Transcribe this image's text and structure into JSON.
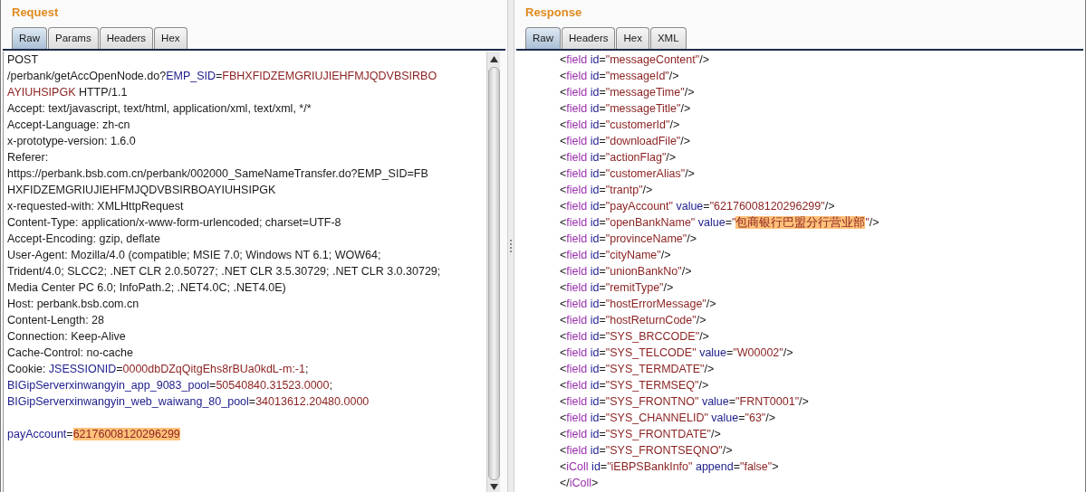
{
  "request": {
    "title": "Request",
    "tabs": [
      {
        "label": "Raw",
        "selected": true
      },
      {
        "label": "Params",
        "selected": false
      },
      {
        "label": "Headers",
        "selected": false
      },
      {
        "label": "Hex",
        "selected": false
      }
    ],
    "lines": [
      {
        "kind": "text",
        "segments": [
          {
            "kind": "plain",
            "text": "POST"
          }
        ]
      },
      {
        "kind": "text",
        "segments": [
          {
            "kind": "plain",
            "text": "/perbank/getAccOpenNode.do?"
          },
          {
            "kind": "name",
            "text": "EMP_SID"
          },
          {
            "kind": "plain",
            "text": "="
          },
          {
            "kind": "value",
            "text": "FBHXFIDZEMGRIUJIEHFMJQDVBSIRBO"
          }
        ]
      },
      {
        "kind": "text",
        "segments": [
          {
            "kind": "value",
            "text": "AYIUHSIPGK"
          },
          {
            "kind": "plain",
            "text": " HTTP/1.1"
          }
        ]
      },
      {
        "kind": "text",
        "segments": [
          {
            "kind": "plain",
            "text": "Accept: text/javascript, text/html, application/xml, text/xml, */*"
          }
        ]
      },
      {
        "kind": "text",
        "segments": [
          {
            "kind": "plain",
            "text": "Accept-Language: zh-cn"
          }
        ]
      },
      {
        "kind": "text",
        "segments": [
          {
            "kind": "plain",
            "text": "x-prototype-version: 1.6.0"
          }
        ]
      },
      {
        "kind": "text",
        "segments": [
          {
            "kind": "plain",
            "text": "Referer:"
          }
        ]
      },
      {
        "kind": "text",
        "segments": [
          {
            "kind": "plain",
            "text": "https://perbank.bsb.com.cn/perbank/002000_SameNameTransfer.do?EMP_SID=FB"
          }
        ]
      },
      {
        "kind": "text",
        "segments": [
          {
            "kind": "plain",
            "text": "HXFIDZEMGRIUJIEHFMJQDVBSIRBOAYIUHSIPGK"
          }
        ]
      },
      {
        "kind": "text",
        "segments": [
          {
            "kind": "plain",
            "text": "x-requested-with: XMLHttpRequest"
          }
        ]
      },
      {
        "kind": "text",
        "segments": [
          {
            "kind": "plain",
            "text": "Content-Type: application/x-www-form-urlencoded; charset=UTF-8"
          }
        ]
      },
      {
        "kind": "text",
        "segments": [
          {
            "kind": "plain",
            "text": "Accept-Encoding: gzip, deflate"
          }
        ]
      },
      {
        "kind": "text",
        "segments": [
          {
            "kind": "plain",
            "text": "User-Agent: Mozilla/4.0 (compatible; MSIE 7.0; Windows NT 6.1; WOW64;"
          }
        ]
      },
      {
        "kind": "text",
        "segments": [
          {
            "kind": "plain",
            "text": "Trident/4.0; SLCC2; .NET CLR 2.0.50727; .NET CLR 3.5.30729; .NET CLR 3.0.30729;"
          }
        ]
      },
      {
        "kind": "text",
        "segments": [
          {
            "kind": "plain",
            "text": "Media Center PC 6.0; InfoPath.2; .NET4.0C; .NET4.0E)"
          }
        ]
      },
      {
        "kind": "text",
        "segments": [
          {
            "kind": "plain",
            "text": "Host: perbank.bsb.com.cn"
          }
        ]
      },
      {
        "kind": "text",
        "segments": [
          {
            "kind": "plain",
            "text": "Content-Length: 28"
          }
        ]
      },
      {
        "kind": "text",
        "segments": [
          {
            "kind": "plain",
            "text": "Connection: Keep-Alive"
          }
        ]
      },
      {
        "kind": "text",
        "segments": [
          {
            "kind": "plain",
            "text": "Cache-Control: no-cache"
          }
        ]
      },
      {
        "kind": "text",
        "segments": [
          {
            "kind": "plain",
            "text": "Cookie: "
          },
          {
            "kind": "name",
            "text": "JSESSIONID"
          },
          {
            "kind": "plain",
            "text": "="
          },
          {
            "kind": "value",
            "text": "0000dbDZqQitgEhs8rBUa0kdL-m:-1"
          },
          {
            "kind": "plain",
            "text": ";"
          }
        ]
      },
      {
        "kind": "text",
        "segments": [
          {
            "kind": "name",
            "text": "BIGipServerxinwangyin_app_9083_pool"
          },
          {
            "kind": "plain",
            "text": "="
          },
          {
            "kind": "value",
            "text": "50540840.31523.0000"
          },
          {
            "kind": "plain",
            "text": ";"
          }
        ]
      },
      {
        "kind": "text",
        "segments": [
          {
            "kind": "name",
            "text": "BIGipServerxinwangyin_web_waiwang_80_pool"
          },
          {
            "kind": "plain",
            "text": "="
          },
          {
            "kind": "value",
            "text": "34013612.20480.0000"
          }
        ]
      },
      {
        "kind": "blank"
      },
      {
        "kind": "text",
        "segments": [
          {
            "kind": "name",
            "text": "payAccount"
          },
          {
            "kind": "plain",
            "text": "="
          },
          {
            "kind": "highlight",
            "text": "62176008120296299"
          }
        ]
      }
    ]
  },
  "response": {
    "title": "Response",
    "tabs": [
      {
        "label": "Raw",
        "selected": true
      },
      {
        "label": "Headers",
        "selected": false
      },
      {
        "label": "Hex",
        "selected": false
      },
      {
        "label": "XML",
        "selected": false
      }
    ],
    "lines": [
      {
        "kind": "text",
        "segments": [
          {
            "kind": "plain",
            "text": "<"
          },
          {
            "kind": "tag",
            "text": "field"
          },
          {
            "kind": "name",
            "text": " id"
          },
          {
            "kind": "plain",
            "text": "="
          },
          {
            "kind": "value",
            "text": "\"messageContent\""
          },
          {
            "kind": "plain",
            "text": "/>"
          }
        ]
      },
      {
        "kind": "text",
        "segments": [
          {
            "kind": "plain",
            "text": "<"
          },
          {
            "kind": "tag",
            "text": "field"
          },
          {
            "kind": "name",
            "text": " id"
          },
          {
            "kind": "plain",
            "text": "="
          },
          {
            "kind": "value",
            "text": "\"messageId\""
          },
          {
            "kind": "plain",
            "text": "/>"
          }
        ]
      },
      {
        "kind": "text",
        "segments": [
          {
            "kind": "plain",
            "text": "<"
          },
          {
            "kind": "tag",
            "text": "field"
          },
          {
            "kind": "name",
            "text": " id"
          },
          {
            "kind": "plain",
            "text": "="
          },
          {
            "kind": "value",
            "text": "\"messageTime\""
          },
          {
            "kind": "plain",
            "text": "/>"
          }
        ]
      },
      {
        "kind": "text",
        "segments": [
          {
            "kind": "plain",
            "text": "<"
          },
          {
            "kind": "tag",
            "text": "field"
          },
          {
            "kind": "name",
            "text": " id"
          },
          {
            "kind": "plain",
            "text": "="
          },
          {
            "kind": "value",
            "text": "\"messageTitle\""
          },
          {
            "kind": "plain",
            "text": "/>"
          }
        ]
      },
      {
        "kind": "text",
        "segments": [
          {
            "kind": "plain",
            "text": "<"
          },
          {
            "kind": "tag",
            "text": "field"
          },
          {
            "kind": "name",
            "text": " id"
          },
          {
            "kind": "plain",
            "text": "="
          },
          {
            "kind": "value",
            "text": "\"customerId\""
          },
          {
            "kind": "plain",
            "text": "/>"
          }
        ]
      },
      {
        "kind": "text",
        "segments": [
          {
            "kind": "plain",
            "text": "<"
          },
          {
            "kind": "tag",
            "text": "field"
          },
          {
            "kind": "name",
            "text": " id"
          },
          {
            "kind": "plain",
            "text": "="
          },
          {
            "kind": "value",
            "text": "\"downloadFile\""
          },
          {
            "kind": "plain",
            "text": "/>"
          }
        ]
      },
      {
        "kind": "text",
        "segments": [
          {
            "kind": "plain",
            "text": "<"
          },
          {
            "kind": "tag",
            "text": "field"
          },
          {
            "kind": "name",
            "text": " id"
          },
          {
            "kind": "plain",
            "text": "="
          },
          {
            "kind": "value",
            "text": "\"actionFlag\""
          },
          {
            "kind": "plain",
            "text": "/>"
          }
        ]
      },
      {
        "kind": "text",
        "segments": [
          {
            "kind": "plain",
            "text": "<"
          },
          {
            "kind": "tag",
            "text": "field"
          },
          {
            "kind": "name",
            "text": " id"
          },
          {
            "kind": "plain",
            "text": "="
          },
          {
            "kind": "value",
            "text": "\"customerAlias\""
          },
          {
            "kind": "plain",
            "text": "/>"
          }
        ]
      },
      {
        "kind": "text",
        "segments": [
          {
            "kind": "plain",
            "text": "<"
          },
          {
            "kind": "tag",
            "text": "field"
          },
          {
            "kind": "name",
            "text": " id"
          },
          {
            "kind": "plain",
            "text": "="
          },
          {
            "kind": "value",
            "text": "\"trantp\""
          },
          {
            "kind": "plain",
            "text": "/>"
          }
        ]
      },
      {
        "kind": "text",
        "segments": [
          {
            "kind": "plain",
            "text": "<"
          },
          {
            "kind": "tag",
            "text": "field"
          },
          {
            "kind": "name",
            "text": " id"
          },
          {
            "kind": "plain",
            "text": "="
          },
          {
            "kind": "value",
            "text": "\"payAccount\""
          },
          {
            "kind": "name",
            "text": " value"
          },
          {
            "kind": "plain",
            "text": "="
          },
          {
            "kind": "value",
            "text": "\"62176008120296299\""
          },
          {
            "kind": "plain",
            "text": "/>"
          }
        ]
      },
      {
        "kind": "text",
        "segments": [
          {
            "kind": "plain",
            "text": "<"
          },
          {
            "kind": "tag",
            "text": "field"
          },
          {
            "kind": "name",
            "text": " id"
          },
          {
            "kind": "plain",
            "text": "="
          },
          {
            "kind": "value",
            "text": "\"openBankName\""
          },
          {
            "kind": "name",
            "text": " value"
          },
          {
            "kind": "plain",
            "text": "="
          },
          {
            "kind": "value",
            "text": "\""
          },
          {
            "kind": "highlight",
            "text": "包商银行巴盟分行营业部"
          },
          {
            "kind": "value",
            "text": "\""
          },
          {
            "kind": "plain",
            "text": "/>"
          }
        ]
      },
      {
        "kind": "text",
        "segments": [
          {
            "kind": "plain",
            "text": "<"
          },
          {
            "kind": "tag",
            "text": "field"
          },
          {
            "kind": "name",
            "text": " id"
          },
          {
            "kind": "plain",
            "text": "="
          },
          {
            "kind": "value",
            "text": "\"provinceName\""
          },
          {
            "kind": "plain",
            "text": "/>"
          }
        ]
      },
      {
        "kind": "text",
        "segments": [
          {
            "kind": "plain",
            "text": "<"
          },
          {
            "kind": "tag",
            "text": "field"
          },
          {
            "kind": "name",
            "text": " id"
          },
          {
            "kind": "plain",
            "text": "="
          },
          {
            "kind": "value",
            "text": "\"cityName\""
          },
          {
            "kind": "plain",
            "text": "/>"
          }
        ]
      },
      {
        "kind": "text",
        "segments": [
          {
            "kind": "plain",
            "text": "<"
          },
          {
            "kind": "tag",
            "text": "field"
          },
          {
            "kind": "name",
            "text": " id"
          },
          {
            "kind": "plain",
            "text": "="
          },
          {
            "kind": "value",
            "text": "\"unionBankNo\""
          },
          {
            "kind": "plain",
            "text": "/>"
          }
        ]
      },
      {
        "kind": "text",
        "segments": [
          {
            "kind": "plain",
            "text": "<"
          },
          {
            "kind": "tag",
            "text": "field"
          },
          {
            "kind": "name",
            "text": " id"
          },
          {
            "kind": "plain",
            "text": "="
          },
          {
            "kind": "value",
            "text": "\"remitType\""
          },
          {
            "kind": "plain",
            "text": "/>"
          }
        ]
      },
      {
        "kind": "text",
        "segments": [
          {
            "kind": "plain",
            "text": "<"
          },
          {
            "kind": "tag",
            "text": "field"
          },
          {
            "kind": "name",
            "text": " id"
          },
          {
            "kind": "plain",
            "text": "="
          },
          {
            "kind": "value",
            "text": "\"hostErrorMessage\""
          },
          {
            "kind": "plain",
            "text": "/>"
          }
        ]
      },
      {
        "kind": "text",
        "segments": [
          {
            "kind": "plain",
            "text": "<"
          },
          {
            "kind": "tag",
            "text": "field"
          },
          {
            "kind": "name",
            "text": " id"
          },
          {
            "kind": "plain",
            "text": "="
          },
          {
            "kind": "value",
            "text": "\"hostReturnCode\""
          },
          {
            "kind": "plain",
            "text": "/>"
          }
        ]
      },
      {
        "kind": "text",
        "segments": [
          {
            "kind": "plain",
            "text": "<"
          },
          {
            "kind": "tag",
            "text": "field"
          },
          {
            "kind": "name",
            "text": " id"
          },
          {
            "kind": "plain",
            "text": "="
          },
          {
            "kind": "value",
            "text": "\"SYS_BRCCODE\""
          },
          {
            "kind": "plain",
            "text": "/>"
          }
        ]
      },
      {
        "kind": "text",
        "segments": [
          {
            "kind": "plain",
            "text": "<"
          },
          {
            "kind": "tag",
            "text": "field"
          },
          {
            "kind": "name",
            "text": " id"
          },
          {
            "kind": "plain",
            "text": "="
          },
          {
            "kind": "value",
            "text": "\"SYS_TELCODE\""
          },
          {
            "kind": "name",
            "text": " value"
          },
          {
            "kind": "plain",
            "text": "="
          },
          {
            "kind": "value",
            "text": "\"W00002\""
          },
          {
            "kind": "plain",
            "text": "/>"
          }
        ]
      },
      {
        "kind": "text",
        "segments": [
          {
            "kind": "plain",
            "text": "<"
          },
          {
            "kind": "tag",
            "text": "field"
          },
          {
            "kind": "name",
            "text": " id"
          },
          {
            "kind": "plain",
            "text": "="
          },
          {
            "kind": "value",
            "text": "\"SYS_TERMDATE\""
          },
          {
            "kind": "plain",
            "text": "/>"
          }
        ]
      },
      {
        "kind": "text",
        "segments": [
          {
            "kind": "plain",
            "text": "<"
          },
          {
            "kind": "tag",
            "text": "field"
          },
          {
            "kind": "name",
            "text": " id"
          },
          {
            "kind": "plain",
            "text": "="
          },
          {
            "kind": "value",
            "text": "\"SYS_TERMSEQ\""
          },
          {
            "kind": "plain",
            "text": "/>"
          }
        ]
      },
      {
        "kind": "text",
        "segments": [
          {
            "kind": "plain",
            "text": "<"
          },
          {
            "kind": "tag",
            "text": "field"
          },
          {
            "kind": "name",
            "text": " id"
          },
          {
            "kind": "plain",
            "text": "="
          },
          {
            "kind": "value",
            "text": "\"SYS_FRONTNO\""
          },
          {
            "kind": "name",
            "text": " value"
          },
          {
            "kind": "plain",
            "text": "="
          },
          {
            "kind": "value",
            "text": "\"FRNT0001\""
          },
          {
            "kind": "plain",
            "text": "/>"
          }
        ]
      },
      {
        "kind": "text",
        "segments": [
          {
            "kind": "plain",
            "text": "<"
          },
          {
            "kind": "tag",
            "text": "field"
          },
          {
            "kind": "name",
            "text": " id"
          },
          {
            "kind": "plain",
            "text": "="
          },
          {
            "kind": "value",
            "text": "\"SYS_CHANNELID\""
          },
          {
            "kind": "name",
            "text": " value"
          },
          {
            "kind": "plain",
            "text": "="
          },
          {
            "kind": "value",
            "text": "\"63\""
          },
          {
            "kind": "plain",
            "text": "/>"
          }
        ]
      },
      {
        "kind": "text",
        "segments": [
          {
            "kind": "plain",
            "text": "<"
          },
          {
            "kind": "tag",
            "text": "field"
          },
          {
            "kind": "name",
            "text": " id"
          },
          {
            "kind": "plain",
            "text": "="
          },
          {
            "kind": "value",
            "text": "\"SYS_FRONTDATE\""
          },
          {
            "kind": "plain",
            "text": "/>"
          }
        ]
      },
      {
        "kind": "text",
        "segments": [
          {
            "kind": "plain",
            "text": "<"
          },
          {
            "kind": "tag",
            "text": "field"
          },
          {
            "kind": "name",
            "text": " id"
          },
          {
            "kind": "plain",
            "text": "="
          },
          {
            "kind": "value",
            "text": "\"SYS_FRONTSEQNO\""
          },
          {
            "kind": "plain",
            "text": "/>"
          }
        ]
      },
      {
        "kind": "text",
        "segments": [
          {
            "kind": "plain",
            "text": "<"
          },
          {
            "kind": "tag",
            "text": "iColl"
          },
          {
            "kind": "name",
            "text": " id"
          },
          {
            "kind": "plain",
            "text": "="
          },
          {
            "kind": "value",
            "text": "\"iEBPSBankInfo\""
          },
          {
            "kind": "name",
            "text": " append"
          },
          {
            "kind": "plain",
            "text": "="
          },
          {
            "kind": "value",
            "text": "\"false\""
          },
          {
            "kind": "plain",
            "text": ">"
          }
        ]
      },
      {
        "kind": "text",
        "segments": [
          {
            "kind": "plain",
            "text": "</"
          },
          {
            "kind": "tag",
            "text": "iColl"
          },
          {
            "kind": "plain",
            "text": ">"
          }
        ]
      }
    ]
  }
}
